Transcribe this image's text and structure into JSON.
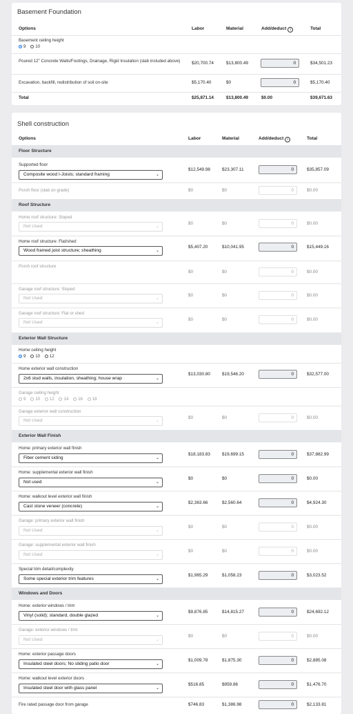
{
  "basement": {
    "title": "Basement Foundation",
    "headers": {
      "options": "Options",
      "labor": "Labor",
      "material": "Material",
      "adjust": "Add/deduct",
      "total": "Total",
      "info": "i"
    },
    "ceiling": {
      "label": "Basement ceiling height",
      "options": [
        "9",
        "10"
      ],
      "selected": "9"
    },
    "rows": [
      {
        "label": "Poured 12\" Concrete Walls/Footings, Drainage, Rigid Insulation (slab included above)",
        "labor": "$20,700.74",
        "material": "$13,800.49",
        "adjust": "0",
        "total": "$34,501.23"
      },
      {
        "label": "Excavation, backfill, redistribution of soil on-site",
        "labor": "$5,170.40",
        "material": "$0",
        "adjust": "0",
        "total": "$5,170.40"
      }
    ],
    "totals": {
      "label": "Total",
      "labor": "$25,871.14",
      "material": "$13,800.49",
      "adjust": "$0.00",
      "total": "$39,671.63"
    }
  },
  "shell": {
    "title": "Shell construction",
    "headers": {
      "options": "Options",
      "labor": "Labor",
      "material": "Material",
      "adjust": "Add/deduct",
      "total": "Total",
      "info": "i"
    },
    "sections": {
      "floor": "Floor Structure",
      "roof": "Roof Structure",
      "ext_wall": "Exterior Wall Structure",
      "ext_finish": "Exterior Wall Finish",
      "windows": "Windows and Doors"
    },
    "rows": {
      "supported_floor": {
        "label": "Supported floor",
        "select": "Composite wood I-Joists; standard framing",
        "labor": "$12,549.98",
        "material": "$23,307.11",
        "adjust": "0",
        "total": "$35,857.09"
      },
      "porch_floor": {
        "label": "Porch floor (slab on grade)",
        "labor": "$0",
        "material": "$0",
        "adjust": "0",
        "total": "$0.00"
      },
      "home_roof_sloped": {
        "label": "Home roof structure: Sloped",
        "select": "Not Used",
        "labor": "$0",
        "material": "$0",
        "adjust": "0",
        "total": "$0.00"
      },
      "home_roof_flat": {
        "label": "Home roof structure: Flat/shed",
        "select": "Wood framed joist structure; sheathing",
        "labor": "$5,407.20",
        "material": "$10,041.95",
        "adjust": "0",
        "total": "$15,449.16"
      },
      "porch_roof": {
        "label": "Porch roof structure",
        "labor": "$0",
        "material": "$0",
        "adjust": "0",
        "total": "$0.00"
      },
      "garage_roof_sloped": {
        "label": "Garage roof structure: Sloped",
        "select": "Not Used",
        "labor": "$0",
        "material": "$0",
        "adjust": "0",
        "total": "$0.00"
      },
      "garage_roof_flat": {
        "label": "Garage roof structure: Flat or shed",
        "select": "Not Used",
        "labor": "$0",
        "material": "$0",
        "adjust": "0",
        "total": "$0.00"
      },
      "home_ceiling": {
        "label": "Home ceiling height",
        "options": [
          "9",
          "10",
          "12"
        ],
        "selected": "9"
      },
      "home_ext_wall": {
        "label": "Home exterior wall construction",
        "select": "2x6 stud walls, insulation, sheathing; house wrap",
        "labor": "$13,030.80",
        "material": "$19,546.20",
        "adjust": "0",
        "total": "$32,577.00"
      },
      "garage_ceiling": {
        "label": "Garage ceiling height",
        "options": [
          "9",
          "10",
          "12",
          "14",
          "16",
          "18"
        ]
      },
      "garage_ext_wall": {
        "label": "Garage exterior wall construction",
        "select": "Not Used",
        "labor": "$0",
        "material": "$0",
        "adjust": "0",
        "total": "$0.00"
      },
      "home_primary_finish": {
        "label": "Home: primary exterior wall finish",
        "select": "Fiber cement siding",
        "labor": "$18,183.83",
        "material": "$19,699.15",
        "adjust": "0",
        "total": "$37,882.99"
      },
      "home_supp_finish": {
        "label": "Home: supplemental exterior wall finish",
        "select": "Not used",
        "labor": "$0",
        "material": "$0",
        "adjust": "0",
        "total": "$0.00"
      },
      "home_walkout_finish": {
        "label": "Home: walkout level exterior wall finish",
        "select": "Cast stone veneer (concrete)",
        "labor": "$2,363.66",
        "material": "$2,560.64",
        "adjust": "0",
        "total": "$4,924.30"
      },
      "garage_primary_finish": {
        "label": "Garage: primary exterior wall finish",
        "select": "Not Used",
        "labor": "$0",
        "material": "$0",
        "adjust": "0",
        "total": "$0.00"
      },
      "garage_supp_finish": {
        "label": "Garage: supplemental exterior wall finish",
        "select": "Not Used",
        "labor": "$0",
        "material": "$0",
        "adjust": "0",
        "total": "$0.00"
      },
      "special_trim": {
        "label": "Special trim detail/complexity",
        "select": "Some special exterior trim features",
        "labor": "$1,965.29",
        "material": "$1,058.23",
        "adjust": "0",
        "total": "$3,023.52"
      },
      "home_windows": {
        "label": "Home: exterior windows / trim",
        "select": "Vinyl (solid); standard, double glazed",
        "labor": "$9,876.85",
        "material": "$14,815.27",
        "adjust": "0",
        "total": "$24,692.12"
      },
      "garage_windows": {
        "label": "Garage: exterior windows / trim",
        "select": "Not Used",
        "labor": "$0",
        "material": "$0",
        "adjust": "0",
        "total": "$0.00"
      },
      "home_passage_doors": {
        "label": "Home: exterior passage doors",
        "select": "Insulated steel doors; No sliding patio door",
        "labor": "$1,009.78",
        "material": "$1,875.30",
        "adjust": "0",
        "total": "$2,885.08"
      },
      "home_walkout_doors": {
        "label": "Home: walkout level exterior doors",
        "select": "Insulated steel door with glass panel",
        "labor": "$516.85",
        "material": "$959.86",
        "adjust": "0",
        "total": "$1,476.70"
      },
      "fire_door": {
        "label": "Fire rated passage door from garage",
        "labor": "$746.83",
        "material": "$1,386.98",
        "adjust": "0",
        "total": "$2,133.81"
      }
    }
  }
}
